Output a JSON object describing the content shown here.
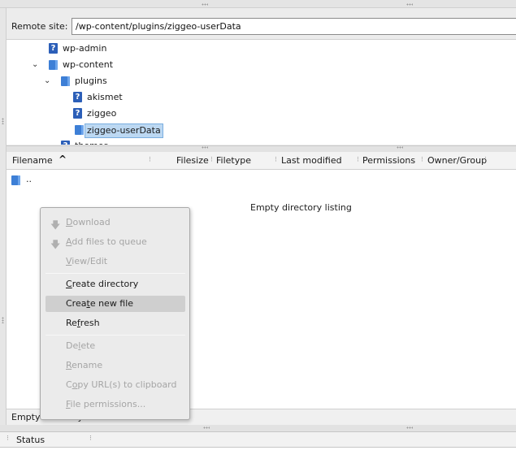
{
  "remote": {
    "label": "Remote site:",
    "path": "/wp-content/plugins/ziggeo-userData"
  },
  "tree": {
    "items": [
      {
        "label": "wp-admin",
        "icon": "unknown-folder-icon"
      },
      {
        "label": "wp-content",
        "icon": "folder-icon",
        "expanded": true
      },
      {
        "label": "plugins",
        "icon": "folder-icon",
        "expanded": true
      },
      {
        "label": "akismet",
        "icon": "unknown-folder-icon"
      },
      {
        "label": "ziggeo",
        "icon": "unknown-folder-icon"
      },
      {
        "label": "ziggeo-userData",
        "icon": "folder-icon",
        "selected": true
      },
      {
        "label": "themes",
        "icon": "unknown-folder-icon"
      }
    ]
  },
  "listing": {
    "columns": [
      "Filename",
      "Filesize",
      "Filetype",
      "Last modified",
      "Permissions",
      "Owner/Group"
    ],
    "sort_indicator": "^",
    "parent_entry": "..",
    "empty_message": "Empty directory listing",
    "status_text": "Empty directory."
  },
  "status_panel": {
    "label": "Status"
  },
  "context_menu": {
    "items": [
      {
        "pre": "",
        "u": "D",
        "post": "ownload",
        "disabled": true,
        "icon": "download-arrow-icon"
      },
      {
        "pre": "",
        "u": "A",
        "post": "dd files to queue",
        "disabled": true,
        "icon": "add-queue-arrow-icon"
      },
      {
        "pre": "",
        "u": "V",
        "post": "iew/Edit",
        "disabled": true
      },
      {
        "pre": "",
        "u": "C",
        "post": "reate directory",
        "disabled": false
      },
      {
        "pre": "Crea",
        "u": "t",
        "post": "e new file",
        "disabled": false,
        "highlighted": true
      },
      {
        "pre": "Re",
        "u": "f",
        "post": "resh",
        "disabled": false
      },
      {
        "pre": "De",
        "u": "l",
        "post": "ete",
        "disabled": true
      },
      {
        "pre": "",
        "u": "R",
        "post": "ename",
        "disabled": true
      },
      {
        "pre": "C",
        "u": "o",
        "post": "py URL(s) to clipboard",
        "disabled": true
      },
      {
        "pre": "",
        "u": "F",
        "post": "ile permissions...",
        "disabled": true
      }
    ]
  },
  "colors": {
    "selection": "#bcd8f2",
    "folder": "#3d7fd6",
    "menu_highlight": "#cfcfcf",
    "disabled_text": "#a5a5a5"
  }
}
